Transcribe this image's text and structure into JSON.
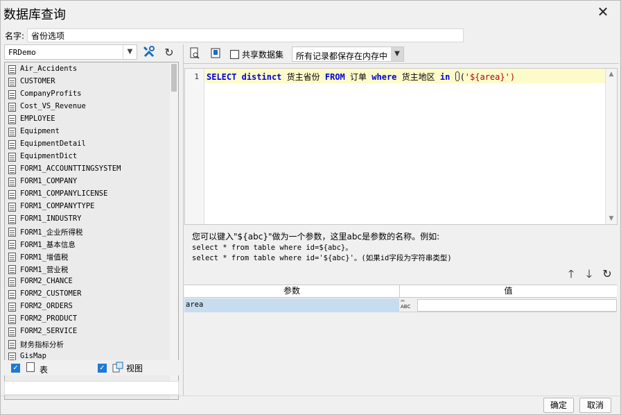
{
  "dialog": {
    "title": "数据库查询",
    "name_label": "名字:",
    "name_value": "省份选项"
  },
  "left": {
    "connection": "FRDemo",
    "tables": [
      "Air_Accidents",
      "CUSTOMER",
      "CompanyProfits",
      "Cost_VS_Revenue",
      "EMPLOYEE",
      "Equipment",
      "EquipmentDetail",
      "EquipmentDict",
      "FORM1_ACCOUNTTINGSYSTEM",
      "FORM1_COMPANY",
      "FORM1_COMPANYLICENSE",
      "FORM1_COMPANYTYPE",
      "FORM1_INDUSTRY",
      "FORM1_企业所得税",
      "FORM1_基本信息",
      "FORM1_增值税",
      "FORM1_营业税",
      "FORM2_CHANCE",
      "FORM2_CUSTOMER",
      "FORM2_ORDERS",
      "FORM2_PRODUCT",
      "FORM2_SERVICE",
      "财务指标分析",
      "GisMap"
    ],
    "filter_tables_label": "表",
    "filter_views_label": "视图"
  },
  "toolbar": {
    "share_label": "共享数据集",
    "cache_mode": "所有记录都保存在内存中"
  },
  "editor": {
    "line_number": "1",
    "kw_select": "SELECT",
    "kw_distinct": "distinct",
    "col": "货主省份",
    "kw_from": "FROM",
    "table": "订单",
    "kw_where": "where",
    "cond_col": "货主地区",
    "kw_in": "in",
    "paren_open": "(",
    "param_str": "'${area}'",
    "paren_close": ")"
  },
  "help": {
    "line1": "您可以键入\"${abc}\"做为一个参数，这里abc是参数的名称。例如:",
    "line2": "select * from table where id=${abc}。",
    "line3": "select * from table where id='${abc}'。(如果id字段为字符串类型)"
  },
  "params": {
    "header_name": "参数",
    "header_value": "值",
    "row_name": "area",
    "row_type": "ABC",
    "row_value": ""
  },
  "footer": {
    "ok_label": "确定",
    "cancel_label": "取消"
  }
}
